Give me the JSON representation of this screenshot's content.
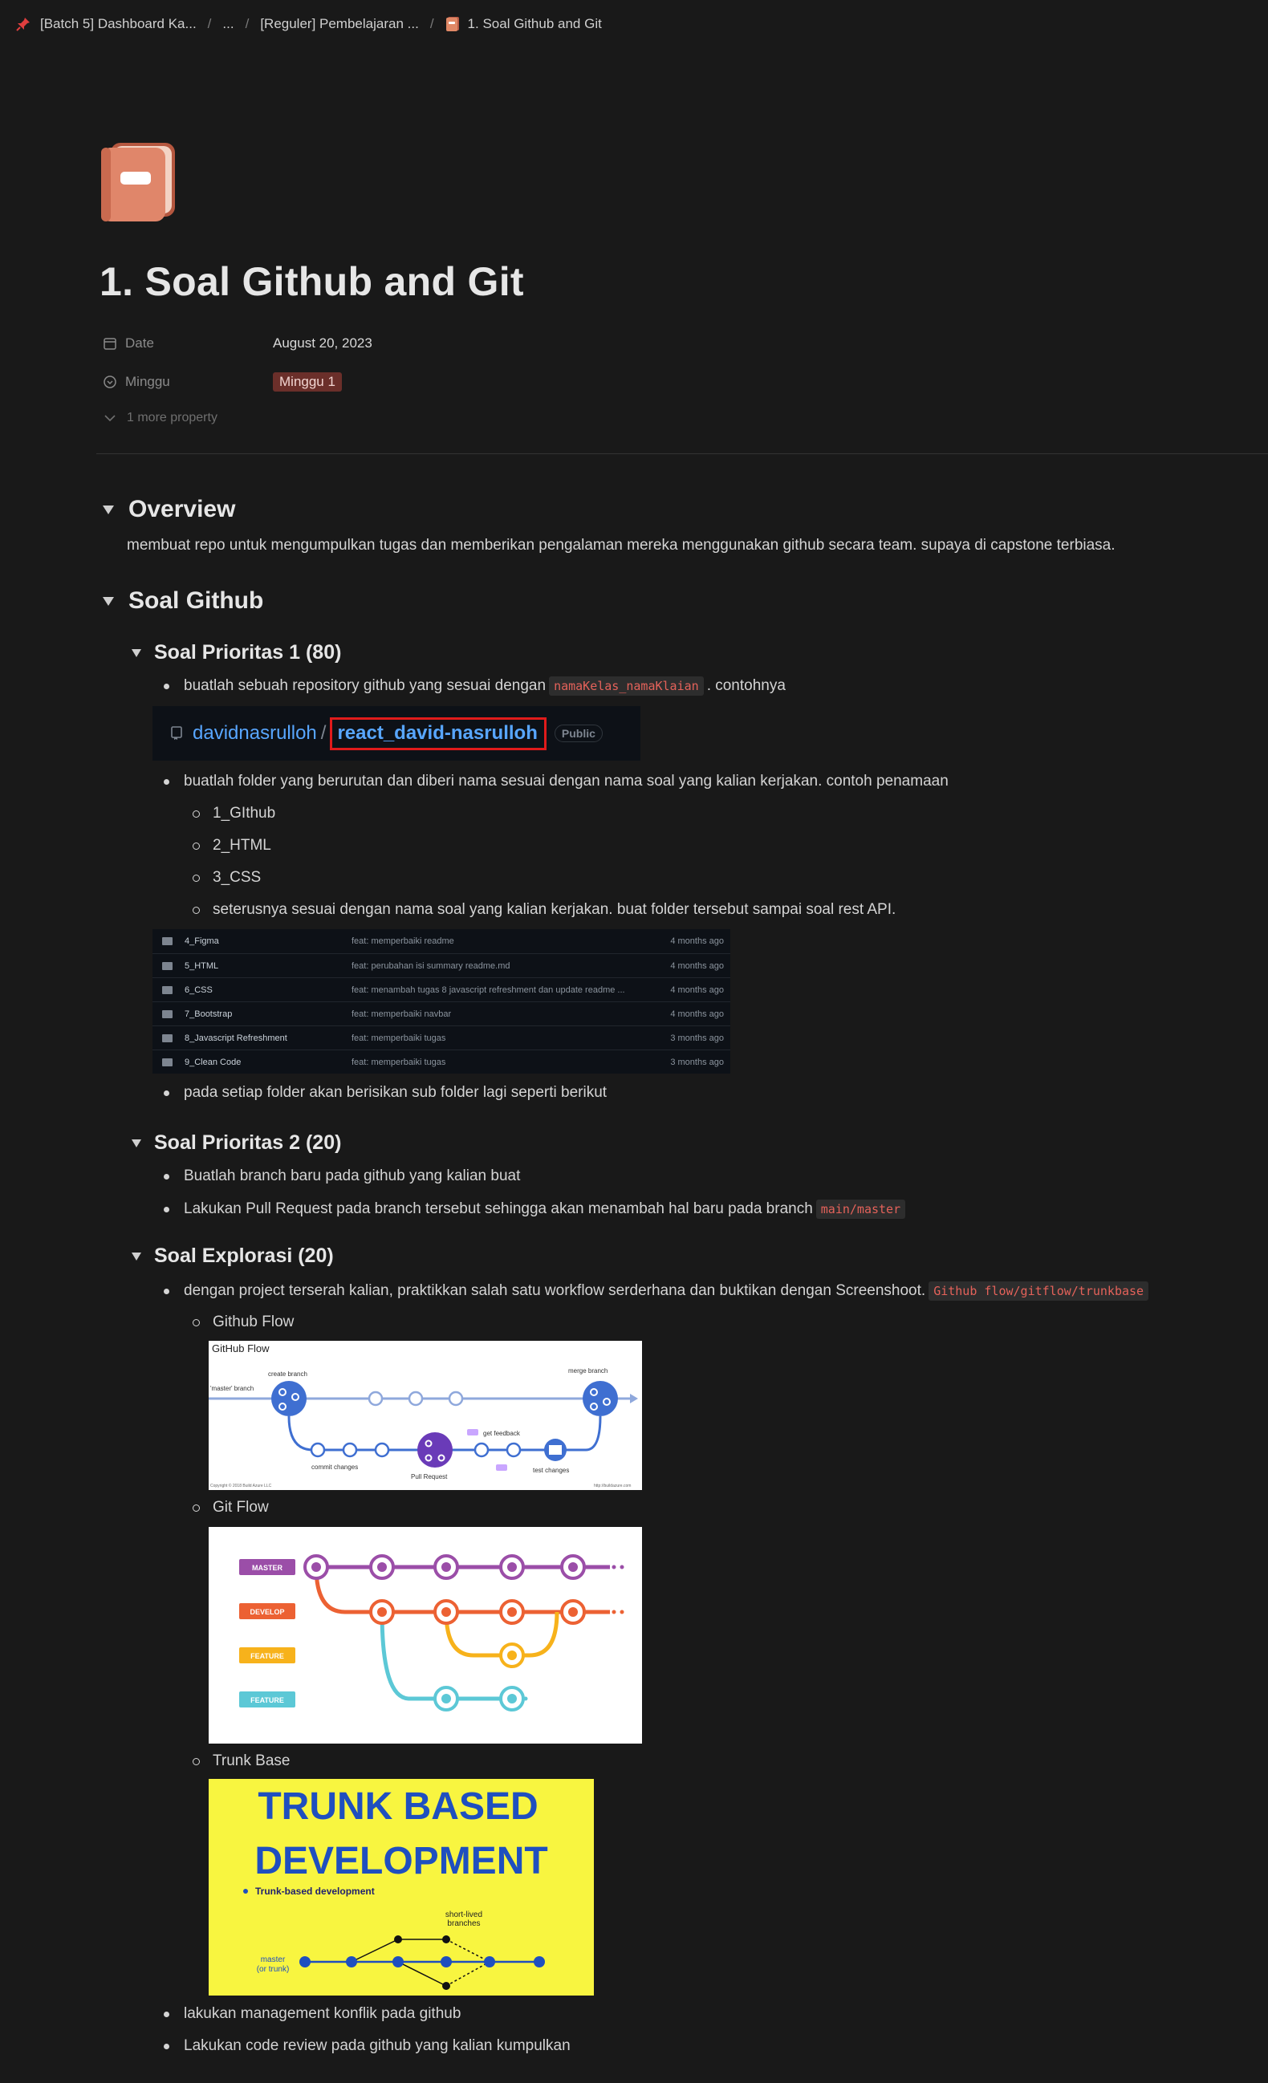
{
  "breadcrumb": {
    "items": [
      "[Batch 5] Dashboard Ka...",
      "...",
      "[Reguler] Pembelajaran ...",
      "1. Soal Github and Git"
    ],
    "separator": "/"
  },
  "page": {
    "title": "1. Soal Github and Git",
    "properties": {
      "date_label": "Date",
      "date_value": "August 20, 2023",
      "minggu_label": "Minggu",
      "minggu_value": "Minggu 1",
      "more_label": "1 more property"
    }
  },
  "overview": {
    "heading": "Overview",
    "text": "membuat repo untuk mengumpulkan tugas dan memberikan pengalaman mereka menggunakan github secara team. supaya di capstone terbiasa."
  },
  "soal_github": {
    "heading": "Soal Github",
    "prioritas1": {
      "heading": "Soal Prioritas 1 (80)",
      "b1_text": "buatlah sebuah repository github yang sesuai dengan",
      "b1_code": "namaKelas_namaKlaian",
      "b1_after": ". contohnya",
      "repo": {
        "owner": "davidnasrulloh",
        "slash": "/",
        "name": "react_david-nasrulloh",
        "badge": "Public"
      },
      "b2_text": "buatlah folder yang berurutan dan diberi nama sesuai dengan nama soal yang kalian kerjakan. contoh penamaan",
      "sub_items": [
        "1_GIthub",
        "2_HTML",
        "3_CSS",
        "seterusnya sesuai dengan nama soal yang kalian kerjakan. buat folder tersebut sampai soal rest API."
      ],
      "folders": [
        {
          "name": "4_Figma",
          "msg": "feat: memperbaiki readme",
          "time": "4 months ago"
        },
        {
          "name": "5_HTML",
          "msg": "feat: perubahan isi summary readme.md",
          "time": "4 months ago"
        },
        {
          "name": "6_CSS",
          "msg": "feat: menambah tugas 8 javascript refreshment dan update readme ...",
          "time": "4 months ago"
        },
        {
          "name": "7_Bootstrap",
          "msg": "feat: memperbaiki navbar",
          "time": "4 months ago"
        },
        {
          "name": "8_Javascript Refreshment",
          "msg": "feat: memperbaiki tugas",
          "time": "3 months ago"
        },
        {
          "name": "9_Clean Code",
          "msg": "feat: memperbaiki tugas",
          "time": "3 months ago"
        }
      ],
      "b3_text": "pada setiap folder akan berisikan sub folder lagi seperti berikut"
    },
    "prioritas2": {
      "heading": "Soal Prioritas 2 (20)",
      "b1_text": "Buatlah branch baru pada github yang kalian buat",
      "b2_text": "Lakukan Pull Request pada branch tersebut sehingga akan menambah hal baru pada branch",
      "b2_code": "main/master"
    },
    "eksplorasi": {
      "heading": "Soal Explorasi (20)",
      "b1_text": "dengan project terserah kalian, praktikkan salah satu workflow serderhana dan buktikan dengan Screenshoot.",
      "b1_code": "Github flow/gitflow/trunkbase",
      "github_flow_label": "Github Flow",
      "github_flow_img": {
        "title": "GitHub Flow",
        "master_branch": "'master' branch",
        "create_branch": "create branch",
        "merge_branch": "merge branch",
        "commit_changes": "commit changes",
        "pull_request": "Pull Request",
        "get_feedback": "get feedback",
        "test_changes": "test changes",
        "copyright": "Copyright © 2018 Build Azure LLC",
        "site": "http://buildazure.com"
      },
      "git_flow_label": "Git Flow",
      "git_flow_img": {
        "branches": [
          "MASTER",
          "DEVELOP",
          "FEATURE",
          "FEATURE"
        ]
      },
      "trunk_label": "Trunk Base",
      "trunk_img": {
        "line1": "TRUNK BASED",
        "line2": "DEVELOPMENT",
        "subtitle": "Trunk-based development",
        "short_lived": "short-lived",
        "branches": "branches",
        "master": "master",
        "or_trunk": "(or trunk)"
      },
      "b2_text": "lakukan management konflik pada github",
      "b3_text": "Lakukan code review pada github yang kalian kumpulkan"
    }
  },
  "colors": {
    "background": "#191919",
    "code": "#e4625a",
    "tag_bg": "#6b2f2a",
    "github_blue": "#58a6ff",
    "trunk_yellow": "#f8f540",
    "trunk_blue": "#1f4fbf"
  }
}
